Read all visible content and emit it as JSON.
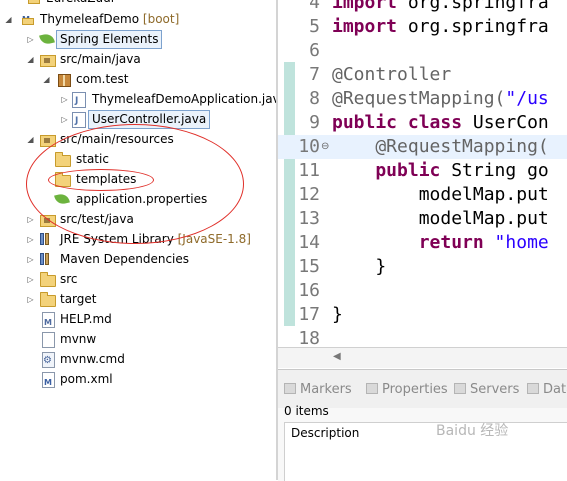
{
  "explorer": {
    "top_partial": "EurekaZuul",
    "project": {
      "name": "ThymeleafDemo",
      "decoration": "[boot]"
    },
    "spring_elements": "Spring Elements",
    "src_main_java": "src/main/java",
    "package": "com.test",
    "file_app": "ThymeleafDemoApplication.java",
    "file_controller": "UserController.java",
    "src_main_resources": "src/main/resources",
    "folder_static": "static",
    "folder_templates": "templates",
    "file_props": "application.properties",
    "src_test_java": "src/test/java",
    "jre": {
      "name": "JRE System Library",
      "decoration": "[JavaSE-1.8]"
    },
    "maven": "Maven Dependencies",
    "folder_src": "src",
    "folder_target": "target",
    "file_help": "HELP.md",
    "file_mvnw": "mvnw",
    "file_mvnw_cmd": "mvnw.cmd",
    "file_pom": "pom.xml"
  },
  "editor": {
    "line_numbers": [
      "4",
      "5",
      "6",
      "7",
      "8",
      "9",
      "10",
      "11",
      "12",
      "13",
      "14",
      "15",
      "16",
      "17",
      "18"
    ],
    "lines": {
      "l4_kw": "import",
      "l4_rest": " org.springfra",
      "l5_kw": "import",
      "l5_rest": " org.springfra",
      "l7": "@Controller",
      "l8_an": "@RequestMapping(",
      "l8_str": "\"/us",
      "l9_kw": "public class",
      "l9_rest": " UserCon",
      "l10": "    @RequestMapping(",
      "l11_kw": "    public",
      "l11_rest": " String go",
      "l12": "        modelMap.put",
      "l13": "        modelMap.put",
      "l14_kw": "        return",
      "l14_str": " \"home",
      "l15": "    }",
      "l17": "}"
    }
  },
  "views": {
    "tabs": [
      "Markers",
      "Properties",
      "Servers",
      "Data"
    ],
    "items_count": "0 items",
    "column_description": "Description"
  },
  "watermark": "Baidu 经验"
}
